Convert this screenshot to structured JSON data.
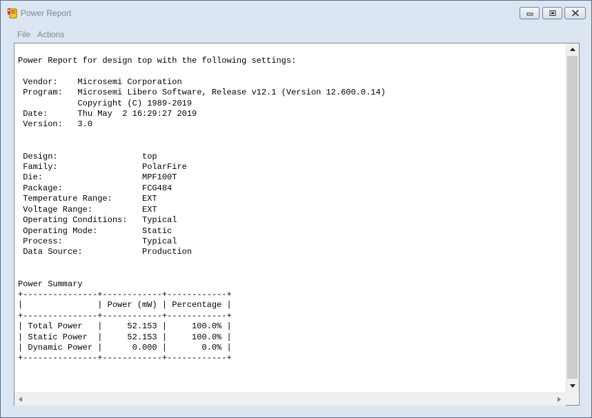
{
  "window": {
    "title": "Power Report",
    "app_icon": "power-report-icon"
  },
  "menu": {
    "items": [
      "File",
      "Actions"
    ]
  },
  "report": {
    "text": "Power Report for design top with the following settings:\n\n Vendor:    Microsemi Corporation\n Program:   Microsemi Libero Software, Release v12.1 (Version 12.600.0.14)\n            Copyright (C) 1989-2019\n Date:      Thu May  2 16:29:27 2019\n Version:   3.0\n\n\n Design:                 top\n Family:                 PolarFire\n Die:                    MPF100T\n Package:                FCG484\n Temperature Range:      EXT\n Voltage Range:          EXT\n Operating Conditions:   Typical\n Operating Mode:         Static\n Process:                Typical\n Data Source:            Production\n\n\nPower Summary\n+---------------+------------+------------+\n|               | Power (mW) | Percentage |\n+---------------+------------+------------+\n| Total Power   |     52.153 |     100.0% |\n| Static Power  |     52.153 |     100.0% |\n| Dynamic Power |      0.000 |       0.0% |\n+---------------+------------+------------+"
  },
  "controls": {
    "minimize_icon": "minimize-icon",
    "maximize_icon": "restore-icon",
    "close_icon": "close-icon"
  },
  "colors": {
    "frame": "#dce6f2",
    "title_text": "#7d8591",
    "content_bg": "#ffffff"
  }
}
